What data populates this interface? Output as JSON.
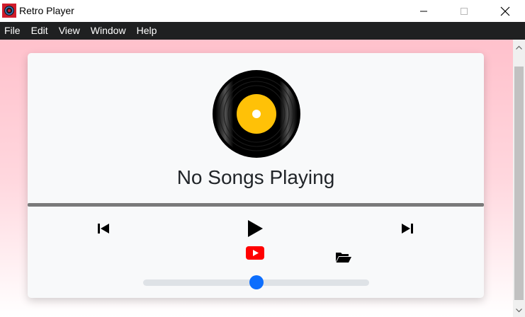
{
  "window": {
    "title": "Retro Player",
    "icon": "retro-player-logo"
  },
  "menu": {
    "items": [
      {
        "label": "File"
      },
      {
        "label": "Edit"
      },
      {
        "label": "View"
      },
      {
        "label": "Window"
      },
      {
        "label": "Help"
      }
    ]
  },
  "player": {
    "song_title": "No Songs Playing",
    "progress": 0,
    "volume": 0.5,
    "icons": {
      "album_art": "vinyl-record-icon",
      "previous": "skip-previous-icon",
      "play": "play-icon",
      "next": "skip-next-icon",
      "youtube": "youtube-icon",
      "folder": "folder-open-icon"
    }
  },
  "colors": {
    "accent": "#0d6efd",
    "background_top": "#ffc1cc",
    "menu_bar": "#1f2021",
    "youtube_red": "#ff0000",
    "vinyl_label": "#ffc107"
  }
}
